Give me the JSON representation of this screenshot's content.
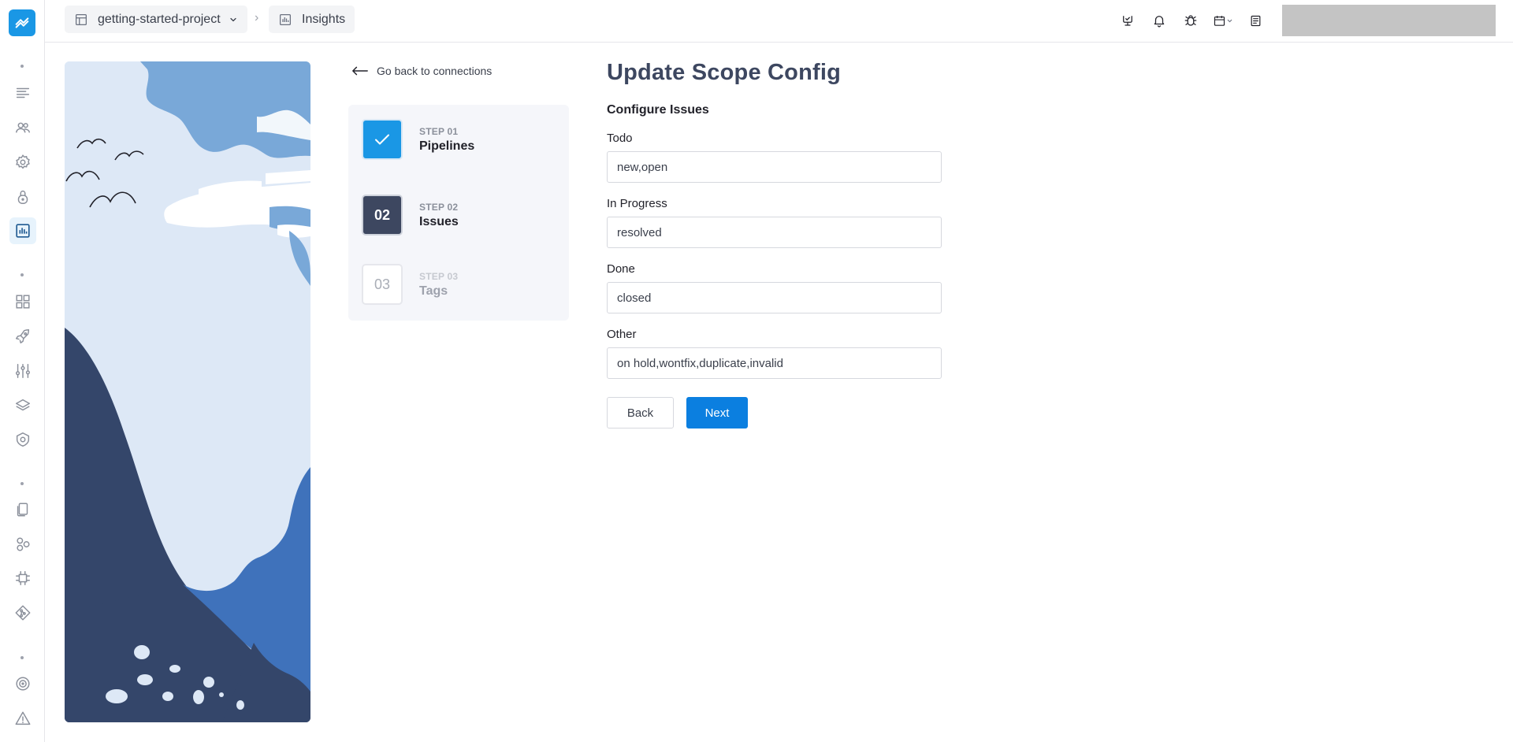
{
  "breadcrumb": {
    "project": "getting-started-project",
    "page": "Insights"
  },
  "back_link": "Go back to connections",
  "steps": [
    {
      "number": "STEP 01",
      "name": "Pipelines",
      "box": "",
      "state": "done"
    },
    {
      "number": "STEP 02",
      "name": "Issues",
      "box": "02",
      "state": "current"
    },
    {
      "number": "STEP 03",
      "name": "Tags",
      "box": "03",
      "state": "pending"
    }
  ],
  "form": {
    "title": "Update Scope Config",
    "section": "Configure Issues",
    "fields": [
      {
        "label": "Todo",
        "value": "new,open"
      },
      {
        "label": "In Progress",
        "value": "resolved"
      },
      {
        "label": "Done",
        "value": "closed"
      },
      {
        "label": "Other",
        "value": "on hold,wontfix,duplicate,invalid"
      }
    ],
    "back_label": "Back",
    "next_label": "Next"
  },
  "icons": {
    "sidebar": [
      "list-icon",
      "users-icon",
      "gear-icon",
      "lock-icon",
      "insights-icon",
      "dashboard-icon",
      "rocket-icon",
      "sliders-icon",
      "layers-icon",
      "shield-icon",
      "documents-icon",
      "shapes-icon",
      "plugin-icon",
      "git-icon",
      "target-icon",
      "warning-icon"
    ],
    "topbar": [
      "monitor-icon",
      "bell-icon",
      "bug-icon",
      "calendar-icon",
      "document-icon"
    ]
  },
  "colors": {
    "accent": "#1a97e5",
    "primary_button": "#0b7fe0",
    "step_current": "#3d4760",
    "title": "#3d4760"
  }
}
